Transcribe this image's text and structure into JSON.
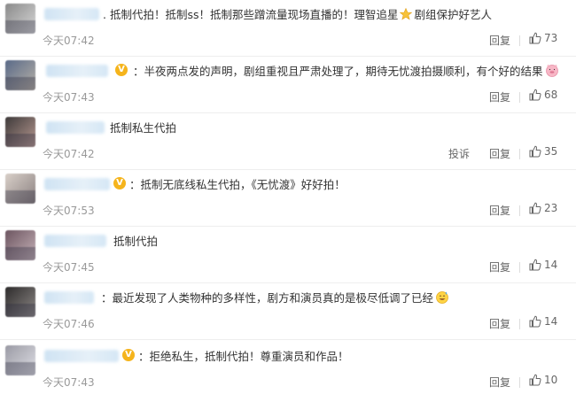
{
  "reply_label": "回复",
  "report_label": "投诉",
  "comments": [
    {
      "text": "抵制代拍！抵制ss！抵制那些蹭流量现场直播的！理智追星",
      "text_after_emoji": "剧组保护好艺人",
      "time": "今天07:42",
      "likes": "73",
      "emoji": "star-icon"
    },
    {
      "text": "半夜两点发的声明，剧组重视且严肃处理了，期待无忧渡拍摄顺利，有个好的结果",
      "time": "今天07:43",
      "likes": "68",
      "emoji": "pig-face-icon"
    },
    {
      "text": "抵制私生代拍",
      "time": "今天07:42",
      "likes": "35"
    },
    {
      "text": "抵制无底线私生代拍，《无忧渡》好好拍！",
      "time": "今天07:53",
      "likes": "23"
    },
    {
      "text": "抵制代拍",
      "time": "今天07:45",
      "likes": "14"
    },
    {
      "text": "最近发现了人类物种的多样性，剧方和演员真的是极尽低调了已经",
      "time": "今天07:46",
      "likes": "14",
      "emoji": "sweat-smile-icon"
    },
    {
      "text": "拒绝私生，抵制代拍！尊重演员和作品！",
      "time": "今天07:43",
      "likes": "10"
    }
  ],
  "colors": {
    "badge": "#f5b41c",
    "meta": "#999999",
    "action": "#666666"
  }
}
